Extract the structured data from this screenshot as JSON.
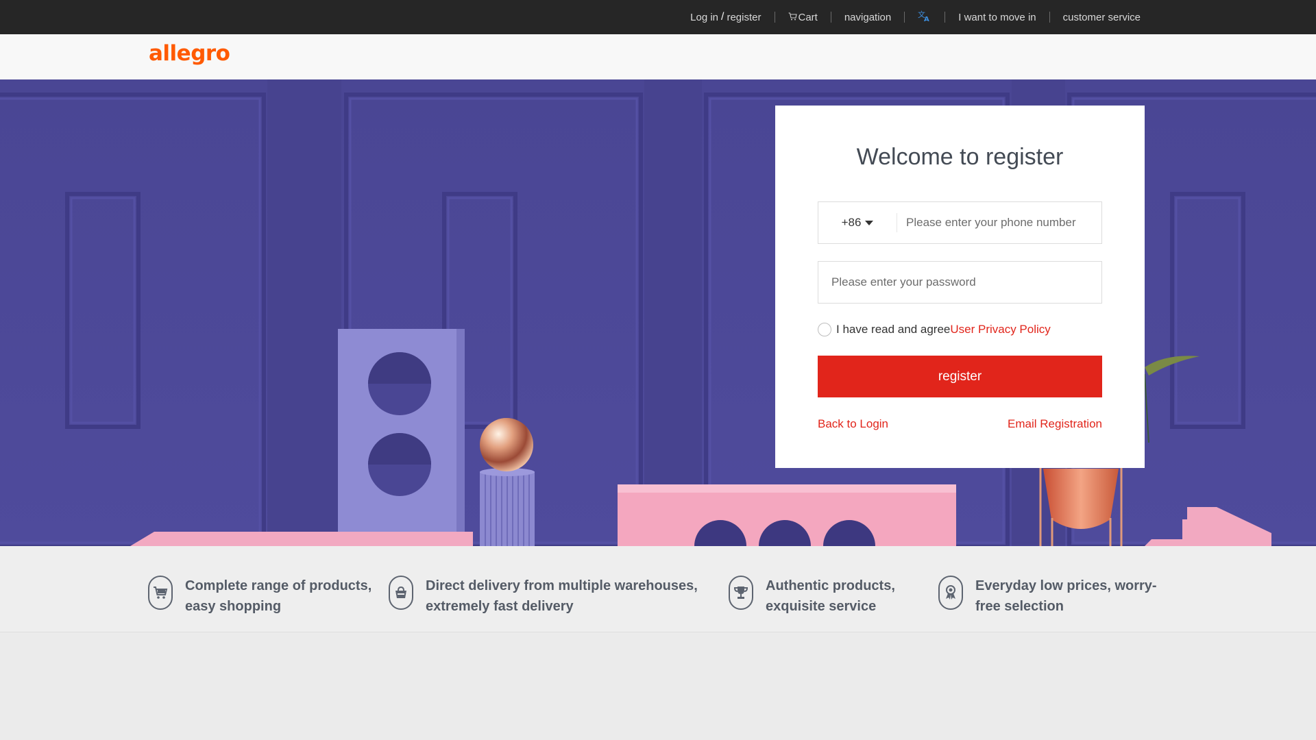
{
  "topnav": {
    "login": "Log in",
    "slash": "/",
    "register": "register",
    "cart": "Cart",
    "navigation": "navigation",
    "language_icon": "translate-icon",
    "move_in": "I want to move in",
    "customer_service": "customer service"
  },
  "header": {
    "logo": "allegro"
  },
  "colors": {
    "accent_red": "#e1251b",
    "logo_orange": "#ff5a00",
    "hero_purple": "#4b4796",
    "topbar": "#262626"
  },
  "register_form": {
    "title": "Welcome to register",
    "country_code": "+86",
    "phone_placeholder": "Please enter your phone number",
    "password_placeholder": "Please enter your password",
    "agree_text": "I have read and agree",
    "policy_link": "User Privacy Policy",
    "submit_label": "register",
    "back_to_login": "Back to Login",
    "email_registration": "Email Registration"
  },
  "features": [
    {
      "icon": "cart-icon",
      "text": "Complete range of products, easy shopping"
    },
    {
      "icon": "delivery-bag-icon",
      "text": "Direct delivery from multiple warehouses, extremely fast delivery"
    },
    {
      "icon": "trophy-icon",
      "text": "Authentic products, exquisite service"
    },
    {
      "icon": "medal-icon",
      "text": "Everyday low prices, worry-free selection"
    }
  ]
}
